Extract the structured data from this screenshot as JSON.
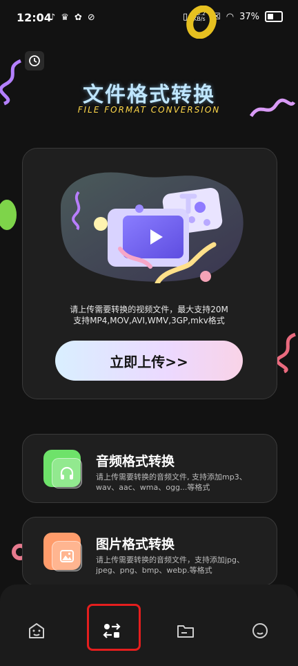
{
  "status_bar": {
    "time": "12:04",
    "network_speed": "13.2 KB/s",
    "battery": "37%"
  },
  "header": {
    "title_cn": "文件格式转换",
    "title_en": "FILE FORMAT CONVERSION"
  },
  "upload_card": {
    "description_line1": "请上传需要转换的视频文件，最大支持20M",
    "description_line2": "支持MP4,MOV,AVI,WMV,3GP,mkv格式",
    "button_label": "立即上传>>"
  },
  "cards": [
    {
      "title": "音频格式转换",
      "description": "请上传需要转换的音频文件, 支持添加mp3、wav、aac、wma、ogg...等格式",
      "color": "#6ee26a"
    },
    {
      "title": "图片格式转换",
      "description": "请上传需要转换的音频文件，支持添加jpg、jpeg、png、bmp、webp.等格式",
      "color": "#ff9c6b"
    }
  ],
  "tabbar": {
    "active_tab": "convert",
    "tabs": [
      "home",
      "convert",
      "files",
      "profile"
    ]
  }
}
